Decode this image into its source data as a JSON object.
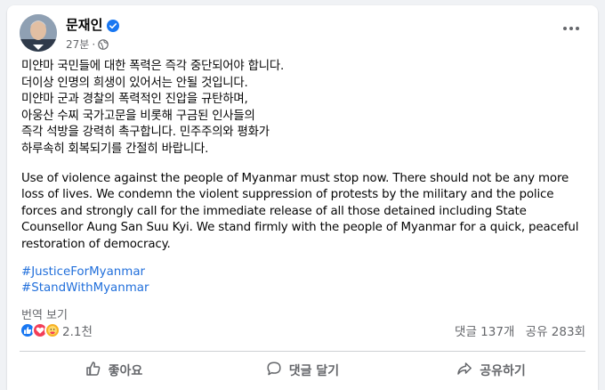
{
  "post": {
    "author": "문재인",
    "time": "27분",
    "dot": "·",
    "korean_lines": [
      "미얀마 국민들에 대한 폭력은 즉각 중단되어야 합니다.",
      "더이상 인명의 희생이 있어서는 안될 것입니다.",
      "미얀마 군과 경찰의 폭력적인 진압을 규탄하며,",
      "아웅산 수찌 국가고문을 비롯해 구금된 인사들의",
      "즉각 석방을 강력히 촉구합니다. 민주주의와 평화가",
      "하루속히 회복되기를 간절히 바랍니다."
    ],
    "english": "Use of violence against the people of Myanmar must stop now. There should not be any more loss of lives. We condemn the violent suppression of protests by the military and the police forces and strongly call for the immediate release of all those detained including State Counsellor Aung San Suu Kyi. We stand firmly with the people of Myanmar for a quick, peaceful restoration of democracy.",
    "hashtags": [
      "#JusticeForMyanmar",
      "#StandWithMyanmar"
    ],
    "translate_label": "번역 보기"
  },
  "stats": {
    "reaction_count": "2.1천",
    "comments": "댓글 137개",
    "shares": "공유 283회"
  },
  "actions": {
    "like": "좋아요",
    "comment": "댓글 달기",
    "share": "공유하기"
  },
  "colors": {
    "accent": "#1877f2",
    "hashtag": "#216fdb",
    "secondary_text": "#65676b"
  }
}
